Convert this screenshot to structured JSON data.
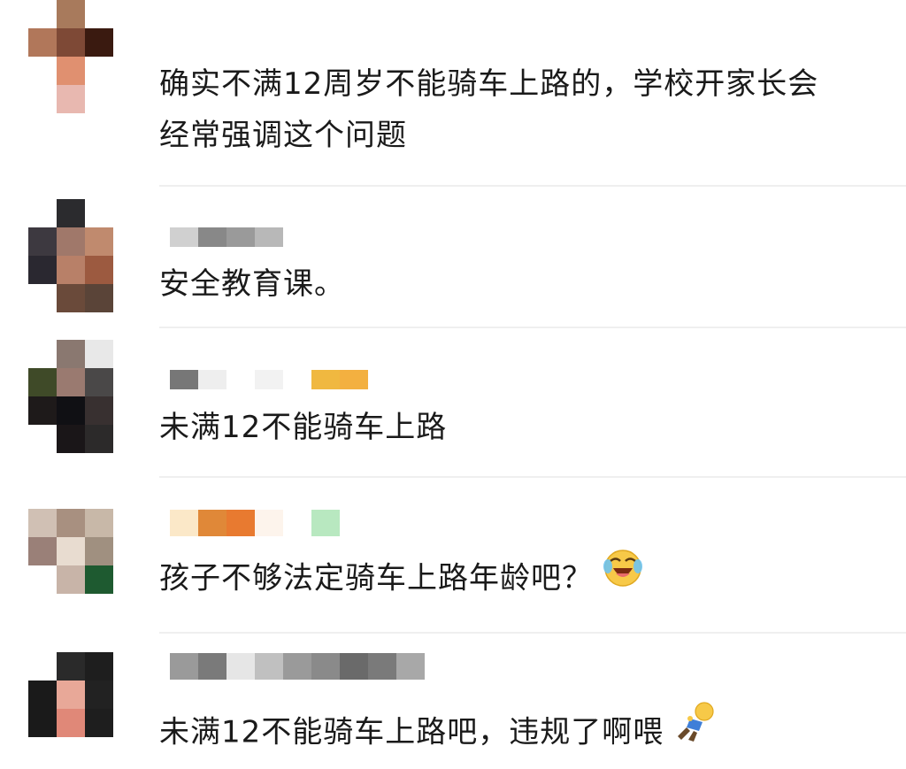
{
  "comments": [
    {
      "text": "确实不满12周岁不能骑车上路的，学校开家长会经常强调这个问题",
      "lines": [
        "确实不满12周岁不能骑车上路的，学校开家长会",
        "经常强调这个问题"
      ],
      "avatar_colors": [
        "#ffffff",
        "#a87a5c",
        "#ffffff",
        "#b1775a",
        "#7e4936",
        "#3a1a10",
        "#ffffff",
        "#e09070",
        "#ffffff",
        "#ffffff",
        "#e8b8b0",
        "#ffffff"
      ]
    },
    {
      "text": "安全教育课。",
      "avatar_colors": [
        "#ffffff",
        "#2b2b2e",
        "#ffffff",
        "#3d3940",
        "#a0786a",
        "#c08a6e",
        "#2a2830",
        "#b88068",
        "#9c5a40",
        "#ffffff",
        "#6a4a3a",
        "#5a4438"
      ]
    },
    {
      "text": "未满12不能骑车上路",
      "avatar_colors": [
        "#ffffff",
        "#8a7870",
        "#e8e8e8",
        "#3f4a28",
        "#9a7a70",
        "#4a4848",
        "#1e1a1a",
        "#101014",
        "#383030",
        "#ffffff",
        "#1a1618",
        "#2c2a2a"
      ]
    },
    {
      "text": "孩子不够法定骑车上路年龄吧？",
      "emoji": "laugh-cry-emoji",
      "avatar_colors": [
        "#d0c0b4",
        "#a89080",
        "#c8b8a8",
        "#9a8078",
        "#e8dcd0",
        "#a09080",
        "#ffffff",
        "#c8b4a8",
        "#1e5a30"
      ]
    },
    {
      "text": "未满12不能骑车上路吧，违规了啊喂",
      "emoji": "fallen-person-emoji",
      "avatar_colors": [
        "#ffffff",
        "#2a2a2a",
        "#1e1e1e",
        "#1a1a1a",
        "#e8a898",
        "#222222",
        "#1a1a1a",
        "#e08878",
        "#1e1e1e"
      ]
    }
  ],
  "name_blurs": [
    [
      "#ffffff"
    ],
    [
      "#d0d0d0",
      "#888888",
      "#9a9a9a",
      "#b8b8b8"
    ],
    [
      "#777777",
      "#eeeeee",
      "#ffffff",
      "#f2f2f2",
      "#ffffff",
      "#f0b840",
      "#f3b040"
    ],
    [
      "#fbe8c8",
      "#e08838",
      "#e87a30",
      "#fdf4ec",
      "#ffffff",
      "#b8e8c0"
    ],
    [
      "#9a9a9a",
      "#7a7a7a",
      "#e6e6e6",
      "#c0c0c0",
      "#9a9a9a",
      "#8a8a8a",
      "#6a6a6a",
      "#7a7a7a",
      "#a8a8a8"
    ]
  ]
}
